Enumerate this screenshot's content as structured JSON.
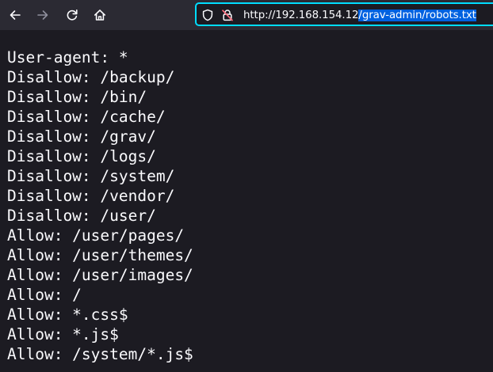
{
  "browser": {
    "url_prefix": "http://192.168.154.12",
    "url_selected": "/grav-admin/robots.txt",
    "icons": {
      "back": "arrow-left-icon",
      "forward": "arrow-right-icon",
      "reload": "reload-icon",
      "home": "home-icon",
      "tracking": "shield-icon",
      "insecure": "lock-slash-icon"
    },
    "colors": {
      "toolbar": "#2b2a33",
      "page": "#1c1b22",
      "focus_ring": "#00ddff",
      "selection": "#0061e0",
      "insecure_lock": "#ff6b7d"
    }
  },
  "robots_txt": {
    "lines": [
      "User-agent: *",
      "Disallow: /backup/",
      "Disallow: /bin/",
      "Disallow: /cache/",
      "Disallow: /grav/",
      "Disallow: /logs/",
      "Disallow: /system/",
      "Disallow: /vendor/",
      "Disallow: /user/",
      "Allow: /user/pages/",
      "Allow: /user/themes/",
      "Allow: /user/images/",
      "Allow: /",
      "Allow: *.css$",
      "Allow: *.js$",
      "Allow: /system/*.js$"
    ]
  }
}
